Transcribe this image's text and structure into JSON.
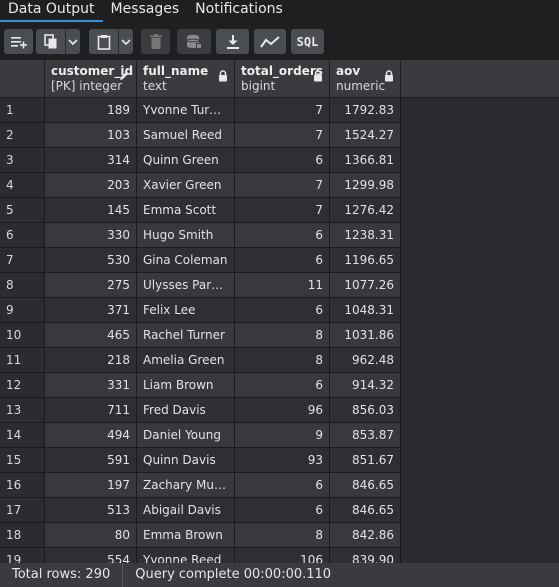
{
  "tabs": [
    {
      "label": "Data Output",
      "active": true
    },
    {
      "label": "Messages",
      "active": false
    },
    {
      "label": "Notifications",
      "active": false
    }
  ],
  "toolbar": {
    "sql_label": "SQL"
  },
  "columns": [
    {
      "name": "customer_id",
      "type": "[PK] integer",
      "icon": "pencil-icon"
    },
    {
      "name": "full_name",
      "type": "text",
      "icon": "lock-icon"
    },
    {
      "name": "total_orders",
      "type": "bigint",
      "icon": "lock-icon"
    },
    {
      "name": "aov",
      "type": "numeric",
      "icon": "lock-icon"
    }
  ],
  "rows": [
    {
      "n": "1",
      "customer_id": "189",
      "full_name": "Yvonne Turner",
      "total_orders": "7",
      "aov": "1792.83"
    },
    {
      "n": "2",
      "customer_id": "103",
      "full_name": "Samuel Reed",
      "total_orders": "7",
      "aov": "1524.27"
    },
    {
      "n": "3",
      "customer_id": "314",
      "full_name": "Quinn Green",
      "total_orders": "6",
      "aov": "1366.81"
    },
    {
      "n": "4",
      "customer_id": "203",
      "full_name": "Xavier Green",
      "total_orders": "7",
      "aov": "1299.98"
    },
    {
      "n": "5",
      "customer_id": "145",
      "full_name": "Emma Scott",
      "total_orders": "7",
      "aov": "1276.42"
    },
    {
      "n": "6",
      "customer_id": "330",
      "full_name": "Hugo Smith",
      "total_orders": "6",
      "aov": "1238.31"
    },
    {
      "n": "7",
      "customer_id": "530",
      "full_name": "Gina Coleman",
      "total_orders": "6",
      "aov": "1196.65"
    },
    {
      "n": "8",
      "customer_id": "275",
      "full_name": "Ulysses Parker",
      "total_orders": "11",
      "aov": "1077.26"
    },
    {
      "n": "9",
      "customer_id": "371",
      "full_name": "Felix Lee",
      "total_orders": "6",
      "aov": "1048.31"
    },
    {
      "n": "10",
      "customer_id": "465",
      "full_name": "Rachel Turner",
      "total_orders": "8",
      "aov": "1031.86"
    },
    {
      "n": "11",
      "customer_id": "218",
      "full_name": "Amelia Green",
      "total_orders": "8",
      "aov": "962.48"
    },
    {
      "n": "12",
      "customer_id": "331",
      "full_name": "Liam Brown",
      "total_orders": "6",
      "aov": "914.32"
    },
    {
      "n": "13",
      "customer_id": "711",
      "full_name": "Fred Davis",
      "total_orders": "96",
      "aov": "856.03"
    },
    {
      "n": "14",
      "customer_id": "494",
      "full_name": "Daniel Young",
      "total_orders": "9",
      "aov": "853.87"
    },
    {
      "n": "15",
      "customer_id": "591",
      "full_name": "Quinn Davis",
      "total_orders": "93",
      "aov": "851.67"
    },
    {
      "n": "16",
      "customer_id": "197",
      "full_name": "Zachary Mur...",
      "total_orders": "6",
      "aov": "846.65"
    },
    {
      "n": "17",
      "customer_id": "513",
      "full_name": "Abigail Davis",
      "total_orders": "6",
      "aov": "846.65"
    },
    {
      "n": "18",
      "customer_id": "80",
      "full_name": "Emma Brown",
      "total_orders": "8",
      "aov": "842.86"
    },
    {
      "n": "19",
      "customer_id": "554",
      "full_name": "Yvonne Reed",
      "total_orders": "106",
      "aov": "839.90"
    }
  ],
  "status": {
    "total_rows": "Total rows: 290",
    "query": "Query complete 00:00:00.110"
  },
  "colors": {
    "accent": "#3c8dd9",
    "background": "#1e1f21",
    "header": "#3a3b3f"
  }
}
